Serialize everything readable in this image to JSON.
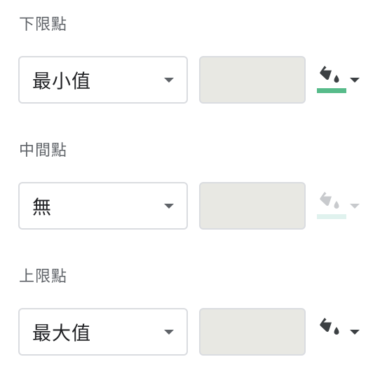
{
  "minpoint": {
    "label": "下限點",
    "type_value": "最小值",
    "value_text": "",
    "fill": {
      "icon": "fill-color-icon",
      "swatch_color": "#57bb8a",
      "enabled": true
    }
  },
  "midpoint": {
    "label": "中間點",
    "type_value": "無",
    "value_text": "",
    "fill": {
      "icon": "fill-color-icon",
      "swatch_color": "#e0f2ee",
      "enabled": false
    }
  },
  "maxpoint": {
    "label": "上限點",
    "type_value": "最大值",
    "value_text": "",
    "fill": {
      "icon": "fill-color-icon",
      "swatch_color": "#ffffff",
      "enabled": true
    }
  },
  "colors": {
    "label_text": "#5f6368",
    "value_text": "#202124",
    "border": "#dadce0",
    "disabled_input_bg": "#e8e8e3",
    "icon_enabled": "#3c4043",
    "icon_disabled": "#c8cacd"
  }
}
